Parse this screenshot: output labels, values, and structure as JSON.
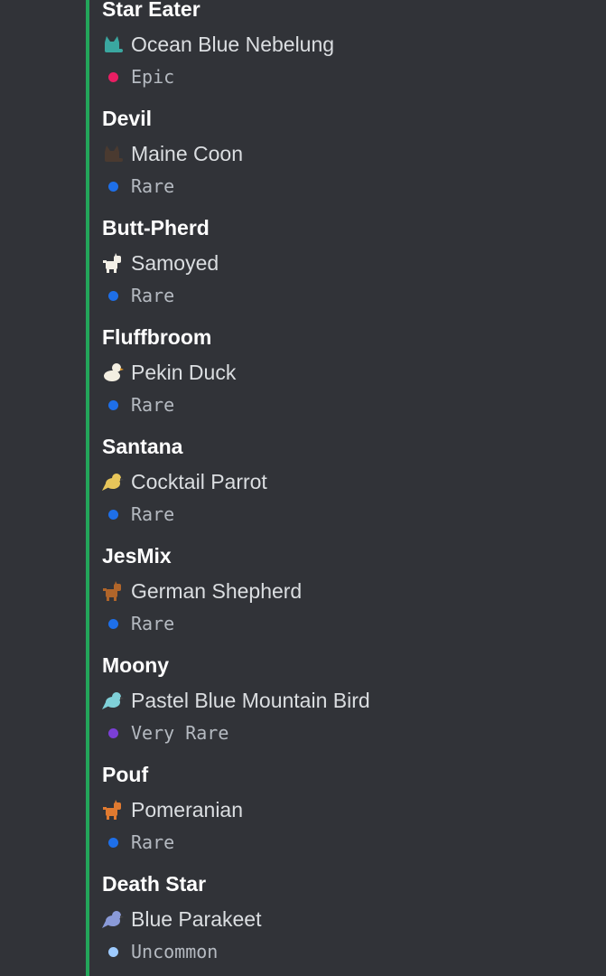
{
  "entries": [
    {
      "owner": "Star Eater",
      "pet": "Ocean Blue Nebelung",
      "pet_icon": "cat-sprite-icon",
      "icon_color": "#3aa7a0",
      "rarity": "Epic",
      "rarity_color": "#e91e63"
    },
    {
      "owner": "Devil",
      "pet": "Maine Coon",
      "pet_icon": "cat-sprite-icon",
      "icon_color": "#4a3a30",
      "rarity": "Rare",
      "rarity_color": "#1e6fe8"
    },
    {
      "owner": "Butt-Pherd",
      "pet": "Samoyed",
      "pet_icon": "dog-sprite-icon",
      "icon_color": "#f2efe6",
      "rarity": "Rare",
      "rarity_color": "#1e6fe8"
    },
    {
      "owner": "Fluffbroom",
      "pet": "Pekin Duck",
      "pet_icon": "duck-sprite-icon",
      "icon_color": "#f3efe2",
      "rarity": "Rare",
      "rarity_color": "#1e6fe8"
    },
    {
      "owner": "Santana",
      "pet": "Cocktail Parrot",
      "pet_icon": "bird-sprite-icon",
      "icon_color": "#e8c65a",
      "rarity": "Rare",
      "rarity_color": "#1e6fe8"
    },
    {
      "owner": "JesMix",
      "pet": "German Shepherd",
      "pet_icon": "dog-sprite-icon",
      "icon_color": "#b0652a",
      "rarity": "Rare",
      "rarity_color": "#1e6fe8"
    },
    {
      "owner": "Moony",
      "pet": "Pastel Blue Mountain Bird",
      "pet_icon": "bird-sprite-icon",
      "icon_color": "#7fd0d8",
      "rarity": "Very Rare",
      "rarity_color": "#7b3fd6"
    },
    {
      "owner": "Pouf",
      "pet": "Pomeranian",
      "pet_icon": "dog-sprite-icon",
      "icon_color": "#e07a30",
      "rarity": "Rare",
      "rarity_color": "#1e6fe8"
    },
    {
      "owner": "Death Star",
      "pet": "Blue Parakeet",
      "pet_icon": "bird-sprite-icon",
      "icon_color": "#8a9ad8",
      "rarity": "Uncommon",
      "rarity_color": "#9ecbff"
    }
  ],
  "accent_color": "#23a55a"
}
